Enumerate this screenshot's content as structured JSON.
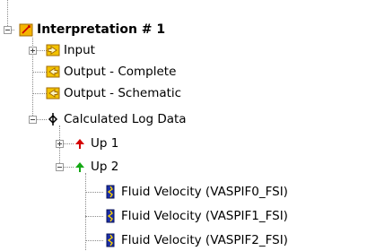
{
  "tree": {
    "root": {
      "label": "Interpretation # 1",
      "icon": "interpretation-folder-icon"
    },
    "input": {
      "label": "Input",
      "icon": "input-arrow-icon"
    },
    "output_complete": {
      "label": "Output - Complete",
      "icon": "output-arrow-icon"
    },
    "output_schematic": {
      "label": "Output - Schematic",
      "icon": "output-arrow-icon"
    },
    "calc": {
      "label": "Calculated Log Data",
      "icon": "log-data-icon"
    },
    "up1": {
      "label": "Up 1",
      "icon": "red-up-arrow-icon"
    },
    "up2": {
      "label": "Up 2",
      "icon": "green-up-arrow-icon"
    },
    "fv0": {
      "label": "Fluid Velocity (VASPIF0_FSI)",
      "icon": "log-curve-icon"
    },
    "fv1": {
      "label": "Fluid Velocity (VASPIF1_FSI)",
      "icon": "log-curve-icon"
    },
    "fv2": {
      "label": "Fluid Velocity (VASPIF2_FSI)",
      "icon": "log-curve-icon"
    }
  }
}
